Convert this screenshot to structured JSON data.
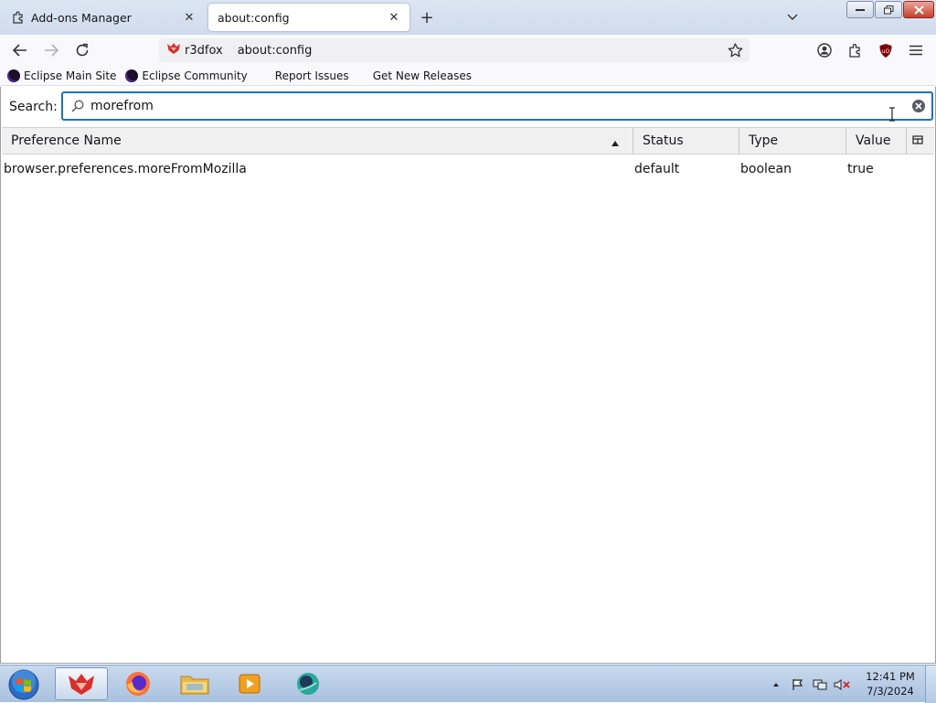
{
  "tabs": [
    {
      "title": "Add-ons Manager",
      "active": false,
      "icon": "puzzle-icon"
    },
    {
      "title": "about:config",
      "active": true,
      "icon": ""
    }
  ],
  "navbar": {
    "identity_label": "r3dfox",
    "url": "about:config"
  },
  "bookmarks": [
    {
      "label": "Eclipse Main Site",
      "icon": "eclipse-icon"
    },
    {
      "label": "Eclipse Community",
      "icon": "eclipse-icon"
    },
    {
      "label": "Report Issues",
      "icon": ""
    },
    {
      "label": "Get New Releases",
      "icon": ""
    }
  ],
  "config": {
    "search_label": "Search:",
    "search_value": "morefrom",
    "columns": {
      "name": "Preference Name",
      "status": "Status",
      "type": "Type",
      "value": "Value"
    },
    "rows": [
      {
        "name": "browser.preferences.moreFromMozilla",
        "status": "default",
        "type": "boolean",
        "value": "true"
      }
    ]
  },
  "taskbar": {
    "clock_time": "12:41 PM",
    "clock_date": "7/3/2024"
  },
  "colors": {
    "accent": "#1a73c9",
    "tab_strip": "#dce6f3",
    "taskbar": "#b9cde7"
  }
}
